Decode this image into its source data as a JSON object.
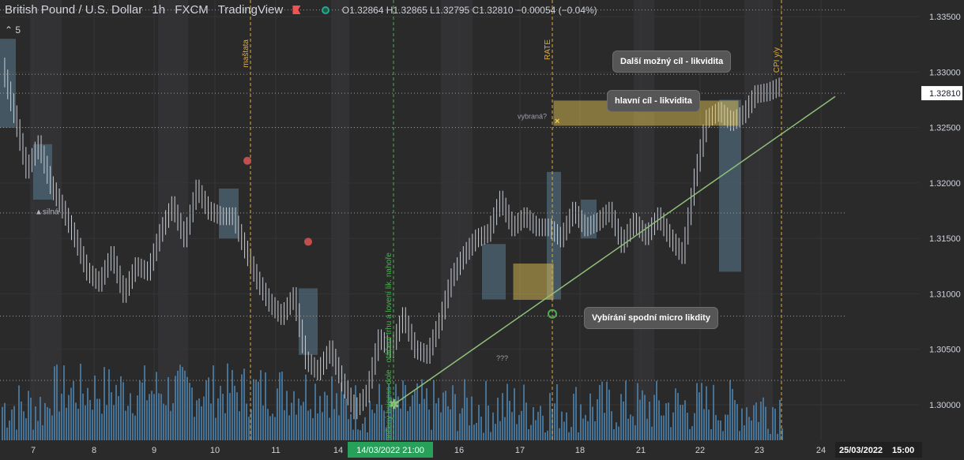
{
  "header": {
    "symbol": "British Pound / U.S. Dollar",
    "interval": "1h",
    "broker": "FXCM",
    "platform": "TradingView",
    "ohlc": "O1.32864 H1.32865 L1.32795 C1.32810 −0.00054 (−0.04%)",
    "indicator_count": "5"
  },
  "annotations": {
    "vertical_1": "maštata",
    "vertical_2": "Ukončený bsiness dole - otáčení trhu a lovení lik. nahoře",
    "vertical_3": "RATE",
    "vertical_4": "CPI y/y",
    "label_silna": "▲silná",
    "label_vybrana": "vybraná?",
    "label_qqq": "???"
  },
  "callouts": {
    "dalsi": "Další možný cíl - likvidita",
    "hlavni": "hlavní cíl - likvidita",
    "vybirani": "Vybírání spodní micro likdity"
  },
  "chart_data": {
    "type": "line",
    "title": "British Pound / U.S. Dollar",
    "xlabel": "",
    "ylabel": "",
    "ylim": [
      1.2968,
      1.3365
    ],
    "yticks": [
      1.335,
      1.33,
      1.325,
      1.32,
      1.315,
      1.31,
      1.305,
      1.3
    ],
    "x_tick_labels": [
      "7",
      "8",
      "9",
      "10",
      "11",
      "14",
      "16",
      "17",
      "18",
      "21",
      "22",
      "23",
      "24"
    ],
    "cursor_x_label": "14/03/2022   21:00",
    "cursor_date_label": "25/03/2022",
    "cursor_time_label": "15:00",
    "last_price": 1.3281,
    "series": [
      {
        "values": [
          1.3305,
          1.3262,
          1.3212,
          1.3235,
          1.3198,
          1.3176,
          1.315,
          1.312,
          1.311,
          1.3135,
          1.31,
          1.3125,
          1.312,
          1.3155,
          1.318,
          1.315,
          1.3195,
          1.3175,
          1.317,
          1.317,
          1.314,
          1.3112,
          1.3092,
          1.308,
          1.3098,
          1.304,
          1.303,
          1.305,
          1.302,
          1.2995,
          1.301,
          1.306,
          1.305,
          1.308,
          1.305,
          1.3045,
          1.3075,
          1.3115,
          1.3135,
          1.315,
          1.3155,
          1.3185,
          1.316,
          1.317,
          1.316,
          1.316,
          1.315,
          1.3175,
          1.316,
          1.3165,
          1.3175,
          1.3145,
          1.3165,
          1.3152,
          1.317,
          1.315,
          1.3135,
          1.3205,
          1.3258,
          1.3265,
          1.3255,
          1.3262,
          1.328,
          1.3282,
          1.3287
        ]
      },
      {
        "name": "",
        "values": [
          1.3,
          1.3275
        ]
      }
    ],
    "horizontal_levels": [
      1.3356,
      1.3298,
      1.3281,
      1.325,
      1.3173,
      1.308,
      1.3022
    ],
    "zones": [
      {
        "from": 1.3252,
        "to": 1.3274
      },
      {
        "from": 1.3095,
        "to": 1.3127
      }
    ],
    "volume_range": [
      0,
      100
    ],
    "grid": true,
    "colors": {
      "background": "#2a2a2b",
      "candles": "#c8ccd4",
      "boxes": "#587a90",
      "volume": "#4a7fa8",
      "trendline": "#8fc079",
      "zone": "#f2cf57",
      "vertical_lines": "#e2a93a",
      "green_line": "#4caf50",
      "price_axis_bg": "#2a2a2b",
      "cursor_label_bg": "#27a05a"
    }
  }
}
